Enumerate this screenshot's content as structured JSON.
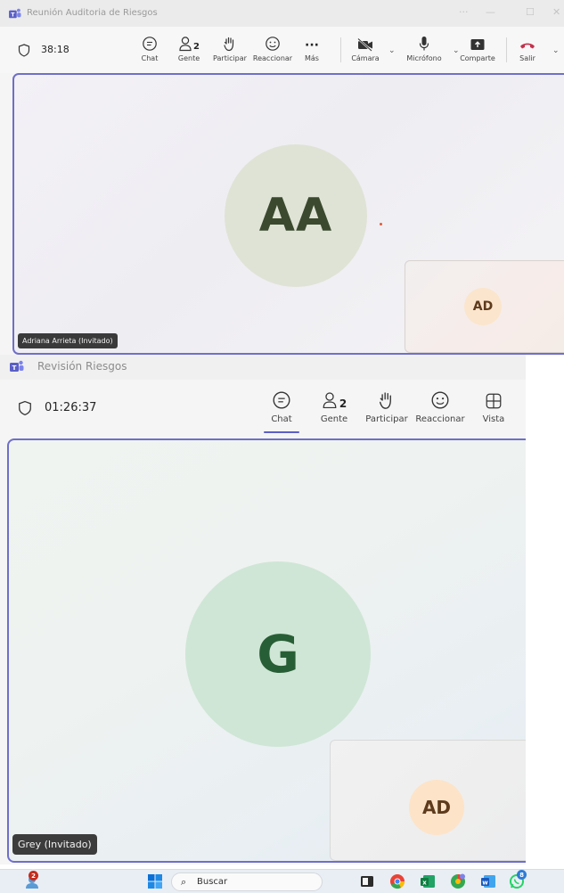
{
  "window_back": {
    "title": "Reunión Auditoria de Riesgos",
    "timer": "38:18",
    "toolbar": {
      "chat": "Chat",
      "people": "Gente",
      "people_count": "2",
      "raise": "Participar",
      "react": "Reaccionar",
      "more": "Más",
      "camera": "Cámara",
      "mic": "Micrófono",
      "share": "Comparte",
      "leave": "Salir"
    },
    "main_participant": {
      "initials": "AA",
      "name_tag": "Adriana Arrieta (Invitado)"
    },
    "self_tile": {
      "initials": "AD"
    }
  },
  "window_front": {
    "title": "Revisión Riesgos",
    "timer": "01:26:37",
    "toolbar": {
      "chat": "Chat",
      "people": "Gente",
      "people_count": "2",
      "raise": "Participar",
      "react": "Reaccionar",
      "view": "Vista"
    },
    "main_participant": {
      "initials": "G",
      "name_tag": "Grey (Invitado)"
    },
    "self_tile": {
      "initials": "AD"
    }
  },
  "taskbar": {
    "search_placeholder": "Buscar",
    "notification_count": "2",
    "whatsapp_badge": "8"
  },
  "colors": {
    "accent": "#5b5fc7",
    "leave_red": "#c4314b",
    "avatar_aa": "#dfe3d6",
    "avatar_g": "#cfe6d6",
    "avatar_ad": "#fde3c8"
  }
}
